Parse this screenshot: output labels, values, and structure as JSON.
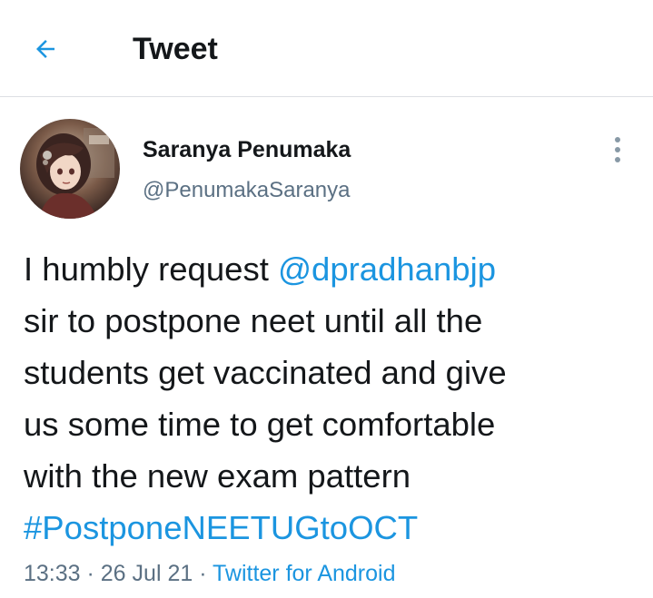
{
  "header": {
    "title": "Tweet",
    "back_icon": "arrow-left-icon"
  },
  "author": {
    "display_name": "Saranya Penumaka",
    "handle": "@PenumakaSaranya",
    "avatar_icon": "avatar-image"
  },
  "more_icon": "vertical-dots-icon",
  "tweet": {
    "line1_text": "I humbly request ",
    "line1_mention": "@dpradhanbjp",
    "line2": "sir to postpone neet until all the",
    "line3": "students get vaccinated and give",
    "line4": "us some time to get comfortable",
    "line5": "with the new exam pattern",
    "hashtag": "#PostponeNEETUGtoOCT"
  },
  "meta": {
    "time": "13:33",
    "sep1": " · ",
    "date": "26 Jul 21",
    "sep2": " · ",
    "source": "Twitter for Android"
  },
  "colors": {
    "accent": "#1b95e0",
    "text": "#14171a",
    "secondary": "#5b7083",
    "divider": "#dcdfe3"
  }
}
